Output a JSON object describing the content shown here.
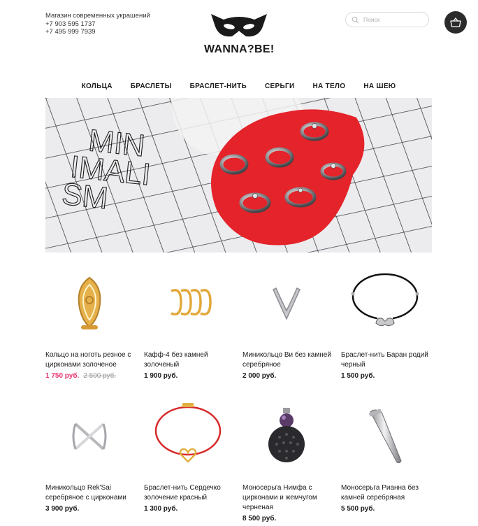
{
  "header": {
    "shop_tagline": "Магазин современных украшений",
    "phone1": "+7 903 595 1737",
    "phone2": "+7 495 999 7939",
    "logo_text": "WANNA?BE!",
    "search_placeholder": "Поиск",
    "cart_icon": "basket-icon"
  },
  "nav": {
    "items": [
      "КОЛЬЦА",
      "БРАСЛЕТЫ",
      "БРАСЛЕТ-НИТЬ",
      "СЕРЬГИ",
      "НА ТЕЛО",
      "НА ШЕЮ"
    ]
  },
  "banner": {
    "text_lines": [
      "MIN",
      "IMALI",
      "SM"
    ],
    "accent_color": "#e5232a"
  },
  "products": [
    {
      "name": "Кольцо на ноготь резное с цирконами золоченое",
      "price": "1 750 руб.",
      "old_price": "2 500 руб.",
      "on_sale": true
    },
    {
      "name": "Кафф-4 без камней золоченый",
      "price": "1 900 руб."
    },
    {
      "name": "Миникольцо Ви без камней серебряное",
      "price": "2 000 руб."
    },
    {
      "name": "Браслет-нить Баран родий черный",
      "price": "1 500 руб."
    },
    {
      "name": "Миникольцо Rek'Sai серебряное с цирконами",
      "price": "3 900 руб."
    },
    {
      "name": "Браслет-нить Сердечко золочение красный",
      "price": "1 300 руб."
    },
    {
      "name": "Моносерьга Нимфа с цирконами и жемчугом черненая",
      "price": "8 500 руб."
    },
    {
      "name": "Моносерьга Рианна без камней серебряная",
      "price": "5 500 руб."
    }
  ],
  "colors": {
    "sale": "#e8366f",
    "text": "#1a1a1a",
    "cart_bg": "#2b2b2b"
  }
}
